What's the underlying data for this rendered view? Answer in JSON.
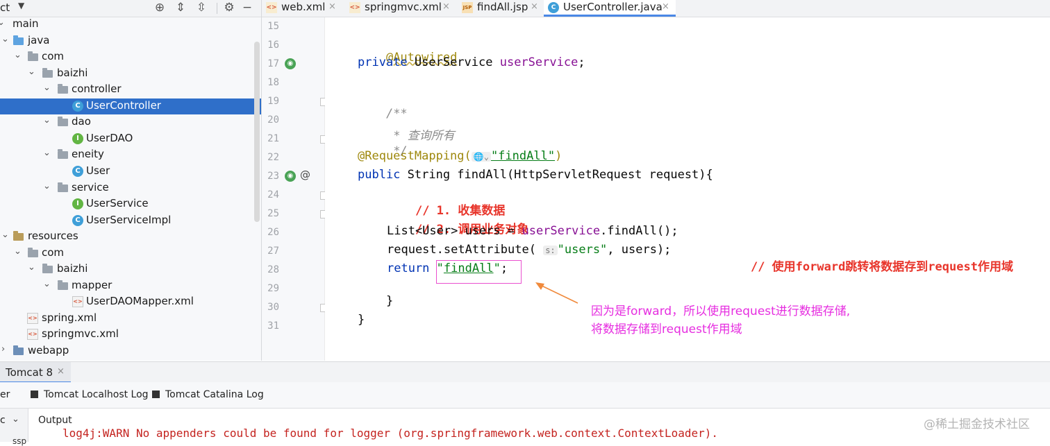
{
  "project_panel": {
    "title": "ct",
    "tree": [
      {
        "label": "main",
        "icon": "folder"
      },
      {
        "label": "java",
        "icon": "folder-java"
      },
      {
        "label": "com",
        "icon": "package"
      },
      {
        "label": "baizhi",
        "icon": "package"
      },
      {
        "label": "controller",
        "icon": "package"
      },
      {
        "label": "UserController",
        "icon": "class",
        "selected": true
      },
      {
        "label": "dao",
        "icon": "package"
      },
      {
        "label": "UserDAO",
        "icon": "interface"
      },
      {
        "label": "eneity",
        "icon": "package"
      },
      {
        "label": "User",
        "icon": "class"
      },
      {
        "label": "service",
        "icon": "package"
      },
      {
        "label": "UserService",
        "icon": "interface"
      },
      {
        "label": "UserServiceImpl",
        "icon": "class"
      },
      {
        "label": "resources",
        "icon": "folder-resources"
      },
      {
        "label": "com",
        "icon": "package"
      },
      {
        "label": "baizhi",
        "icon": "package"
      },
      {
        "label": "mapper",
        "icon": "package"
      },
      {
        "label": "UserDAOMapper.xml",
        "icon": "xml"
      },
      {
        "label": "spring.xml",
        "icon": "xml"
      },
      {
        "label": "springmvc.xml",
        "icon": "xml"
      },
      {
        "label": "webapp",
        "icon": "folder-web"
      }
    ],
    "class_letter": "C",
    "interface_letter": "I",
    "xml_letter": "<>"
  },
  "editor_tabs": [
    {
      "label": "web.xml",
      "icon": "xml-file-icon",
      "active": false
    },
    {
      "label": "springmvc.xml",
      "icon": "xml-file-icon",
      "active": false
    },
    {
      "label": "findAll.jsp",
      "icon": "jsp-file-icon",
      "active": false
    },
    {
      "label": "UserController.java",
      "icon": "java-class-icon",
      "active": true
    }
  ],
  "tab_icon_text": {
    "xml": "<>",
    "jsp": "JSP",
    "java": "C"
  },
  "line_numbers": [
    "15",
    "16",
    "17",
    "18",
    "19",
    "20",
    "21",
    "22",
    "23",
    "24",
    "25",
    "26",
    "27",
    "28",
    "29",
    "30",
    "31"
  ],
  "code": {
    "l16": "@Autowired",
    "l17_kw": "private",
    "l17_type": " UserService ",
    "l17_field": "userService",
    "l17_end": ";",
    "l19": "/**",
    "l20": " * 查询所有",
    "l21": " */",
    "l22_ann": "@RequestMapping(",
    "l22_hint": "🌐⌄",
    "l22_str": "\"findAll\"",
    "l22_end": ")",
    "l23_kw": "public",
    "l23_rest": " String findAll(HttpServletRequest request){",
    "l24": "// 1. 收集数据",
    "l25": "// 2. 调用业务对象",
    "l26_a": "List<User> users = ",
    "l26_field": "userService",
    "l26_b": ".findAll();",
    "l27_a": "request.setAttribute(",
    "l27_hint": "s:",
    "l27_str": "\"users\"",
    "l27_b": ", users);",
    "l27_comment": "// 使用forward跳转将数据存到request作用域",
    "l28_kw": "return",
    "l28_q1": " \"",
    "l28_str": "findAll",
    "l28_q2": "\"",
    "l28_end": ";",
    "l29": "}",
    "l30": "}"
  },
  "annotation": {
    "line1": "因为是forward，所以使用request进行数据存储,",
    "line2": "将数据存储到request作用域",
    "color": "#e62ee0"
  },
  "bottom": {
    "tomcat_tab": "Tomcat 8",
    "tomcat_close": "×",
    "left_cut_label": "er",
    "log_tabs": [
      "Tomcat Localhost Log",
      "Tomcat Catalina Log"
    ],
    "output_left": "c",
    "output_label": "Output",
    "log_line": "log4j:WARN No appenders could be found for logger (org.springframework.web.context.ContextLoader).",
    "ssp": "ssp",
    "watermark": "@稀土掘金技术社区"
  },
  "colors": {
    "selection": "#2f6fc9",
    "keyword": "#0033b3",
    "annotation": "#9e880d",
    "string": "#067d17",
    "field": "#871094",
    "red_comment": "#e8352b",
    "highlight_box": "#ea4fcf",
    "arrow": "#f08a3c"
  }
}
